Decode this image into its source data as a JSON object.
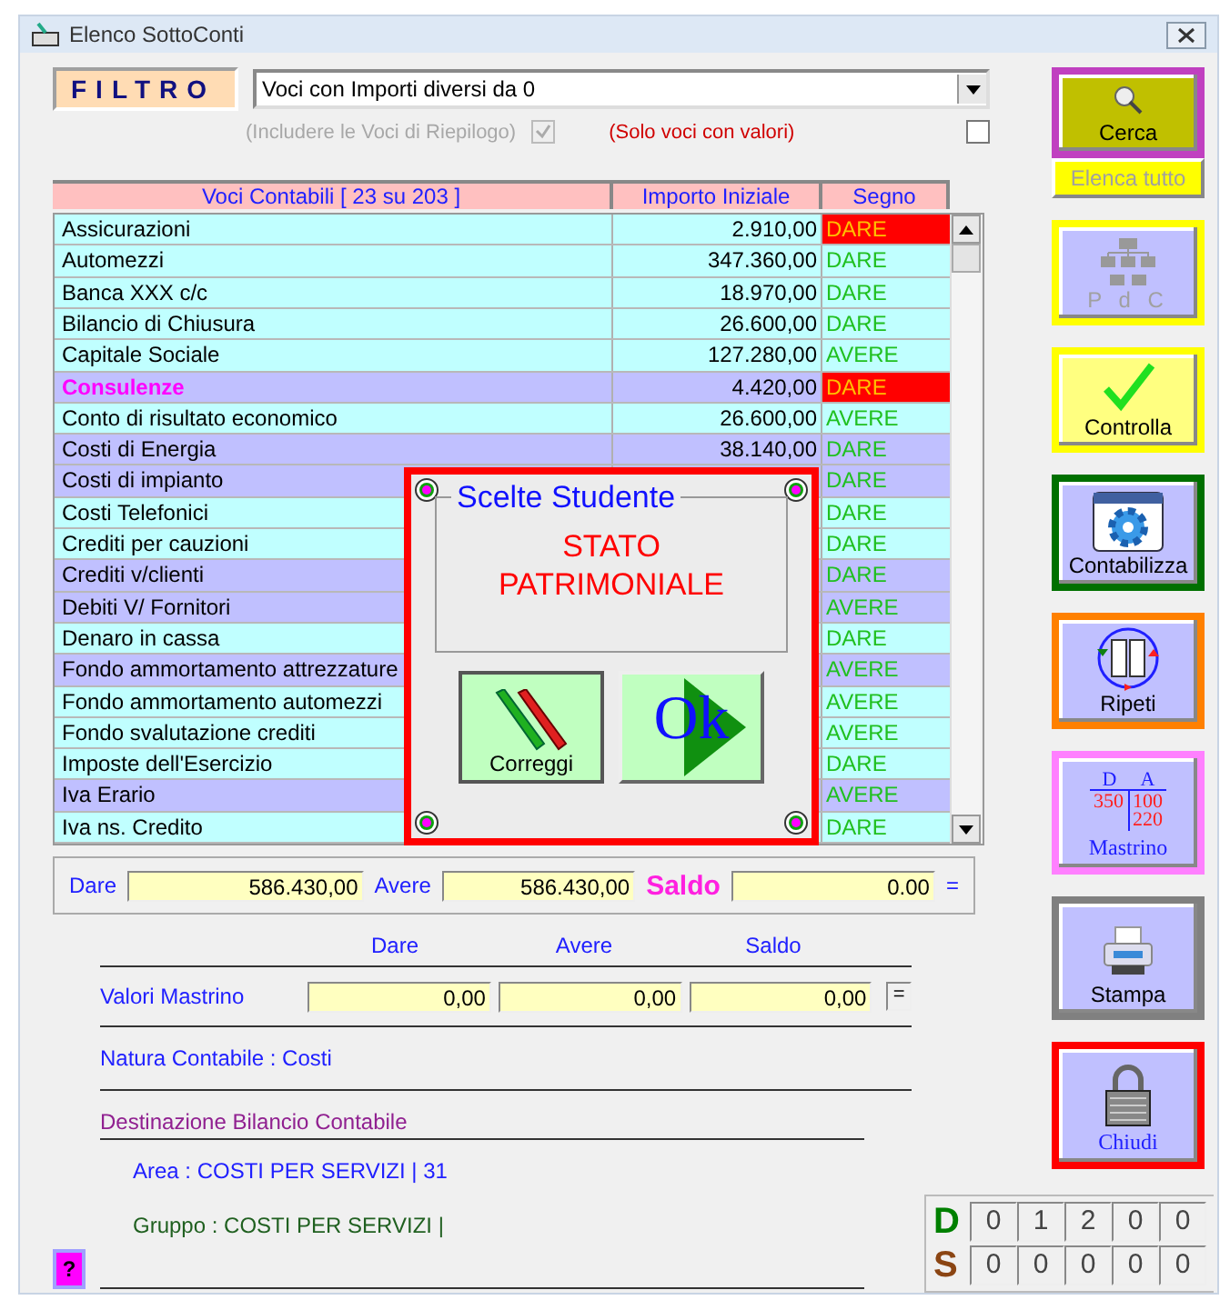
{
  "window": {
    "title": "Elenco SottoConti"
  },
  "filter": {
    "label": "FILTRO",
    "value": "Voci con Importi diversi da 0",
    "options": [
      {
        "label": "(Includere le Voci di Riepilogo)",
        "checked": true,
        "disabled": true
      },
      {
        "label": "(Solo voci con valori)",
        "checked": false,
        "disabled": false
      }
    ]
  },
  "table": {
    "columns": [
      "Voci Contabili [ 23 su 203 ]",
      "Importo Iniziale",
      "Segno"
    ],
    "rows": [
      {
        "name": "Assicurazioni",
        "amount": "2.910,00",
        "sign": "DARE",
        "color": "#c0ffff",
        "selected": false,
        "flagged": true
      },
      {
        "name": "Automezzi",
        "amount": "347.360,00",
        "sign": "DARE",
        "color": "#c0ffff",
        "selected": false,
        "flagged": false
      },
      {
        "name": "Banca XXX c/c",
        "amount": "18.970,00",
        "sign": "DARE",
        "color": "#c0ffff",
        "selected": false,
        "flagged": false
      },
      {
        "name": "Bilancio di Chiusura",
        "amount": "26.600,00",
        "sign": "DARE",
        "color": "#c0ffff",
        "selected": false,
        "flagged": false
      },
      {
        "name": "Capitale Sociale",
        "amount": "127.280,00",
        "sign": "AVERE",
        "color": "#c0ffff",
        "selected": false,
        "flagged": false
      },
      {
        "name": "Consulenze",
        "amount": "4.420,00",
        "sign": "DARE",
        "color": "#c0c0ff",
        "selected": true,
        "flagged": true
      },
      {
        "name": "Conto di risultato economico",
        "amount": "26.600,00",
        "sign": "AVERE",
        "color": "#c0ffff",
        "selected": false,
        "flagged": false
      },
      {
        "name": "Costi di Energia",
        "amount": "38.140,00",
        "sign": "DARE",
        "color": "#c0c0ff",
        "selected": false,
        "flagged": false
      },
      {
        "name": "Costi di impianto",
        "sign": "DARE",
        "color": "#c0c0ff",
        "selected": false,
        "flagged": false
      },
      {
        "name": "Costi Telefonici",
        "sign": "DARE",
        "color": "#c0ffff",
        "selected": false,
        "flagged": false
      },
      {
        "name": "Crediti per cauzioni",
        "sign": "DARE",
        "color": "#c0ffff",
        "selected": false,
        "flagged": false
      },
      {
        "name": "Crediti v/clienti",
        "sign": "DARE",
        "color": "#c0c0ff",
        "selected": false,
        "flagged": false
      },
      {
        "name": "Debiti V/ Fornitori",
        "sign": "AVERE",
        "color": "#c0c0ff",
        "selected": false,
        "flagged": false
      },
      {
        "name": "Denaro in cassa",
        "sign": "DARE",
        "color": "#c0ffff",
        "selected": false,
        "flagged": false
      },
      {
        "name": "Fondo ammortamento attrezzature",
        "sign": "AVERE",
        "color": "#c0c0ff",
        "selected": false,
        "flagged": false
      },
      {
        "name": "Fondo ammortamento automezzi",
        "sign": "AVERE",
        "color": "#c0ffff",
        "selected": false,
        "flagged": false
      },
      {
        "name": "Fondo svalutazione crediti",
        "sign": "AVERE",
        "color": "#c0ffff",
        "selected": false,
        "flagged": false
      },
      {
        "name": "Imposte dell'Esercizio",
        "sign": "DARE",
        "color": "#c0ffff",
        "selected": false,
        "flagged": false
      },
      {
        "name": "Iva Erario",
        "sign": "AVERE",
        "color": "#c0c0ff",
        "selected": false,
        "flagged": false
      },
      {
        "name": "Iva ns. Credito",
        "sign": "DARE",
        "color": "#c0ffff",
        "selected": false,
        "flagged": false
      }
    ]
  },
  "dialog": {
    "legend": "Scelte Studente",
    "choice": "STATO PATRIMONIALE",
    "buttons": [
      {
        "kind": "pencils",
        "label": "Correggi"
      },
      {
        "kind": "ok",
        "label": "Ok"
      }
    ]
  },
  "totals": {
    "fields": [
      {
        "kind": "plain",
        "label": "Dare",
        "value": "586.430,00"
      },
      {
        "kind": "plain",
        "label": "Avere",
        "value": "586.430,00"
      },
      {
        "kind": "balance",
        "label": "Saldo",
        "value": "0.00"
      }
    ],
    "suffix": "="
  },
  "ledger": {
    "headings": [
      "Dare",
      "Avere",
      "Saldo"
    ],
    "label": "Valori Mastrino",
    "values": [
      "0,00",
      "0,00",
      "0,00"
    ],
    "suffix": "="
  },
  "nature": "Natura Contabile : Costi",
  "destination": {
    "title": "Destinazione Bilancio Contabile",
    "area": "Area : COSTI PER SERVIZI | 31",
    "group": "Gruppo : COSTI PER SERVIZI |"
  },
  "help_button": "?",
  "actions": [
    {
      "kind": "search",
      "label": "Cerca",
      "color": "#c040c0",
      "disabled": false,
      "secondary": "Elenca tutto"
    },
    {
      "kind": "chart",
      "label": "P d C",
      "color": "#ffff00",
      "disabled": true
    },
    {
      "kind": "check",
      "label": "Controlla",
      "color": "#ffff00",
      "disabled": false
    },
    {
      "kind": "gear",
      "label": "Contabilizza",
      "color": "#007000",
      "disabled": false
    },
    {
      "kind": "repeat",
      "label": "Ripeti",
      "color": "#ff8000",
      "disabled": false
    },
    {
      "kind": "ledger",
      "label": "Mastrino",
      "color": "#ff80ff",
      "disabled": false,
      "ledger": {
        "debit_head": "D",
        "credit_head": "A",
        "debit": [
          "350"
        ],
        "credit": [
          "100",
          "220"
        ]
      }
    },
    {
      "kind": "print",
      "label": "Stampa",
      "color": "#808080",
      "disabled": false
    },
    {
      "kind": "lock",
      "label": "Chiudi",
      "color": "#ff0000",
      "disabled": false
    }
  ],
  "counters": [
    {
      "label": "D",
      "color": "#008000",
      "digits": [
        "0",
        "1",
        "2",
        "0",
        "0"
      ]
    },
    {
      "label": "S",
      "color": "#8b4513",
      "digits": [
        "0",
        "0",
        "0",
        "0",
        "0"
      ]
    }
  ]
}
